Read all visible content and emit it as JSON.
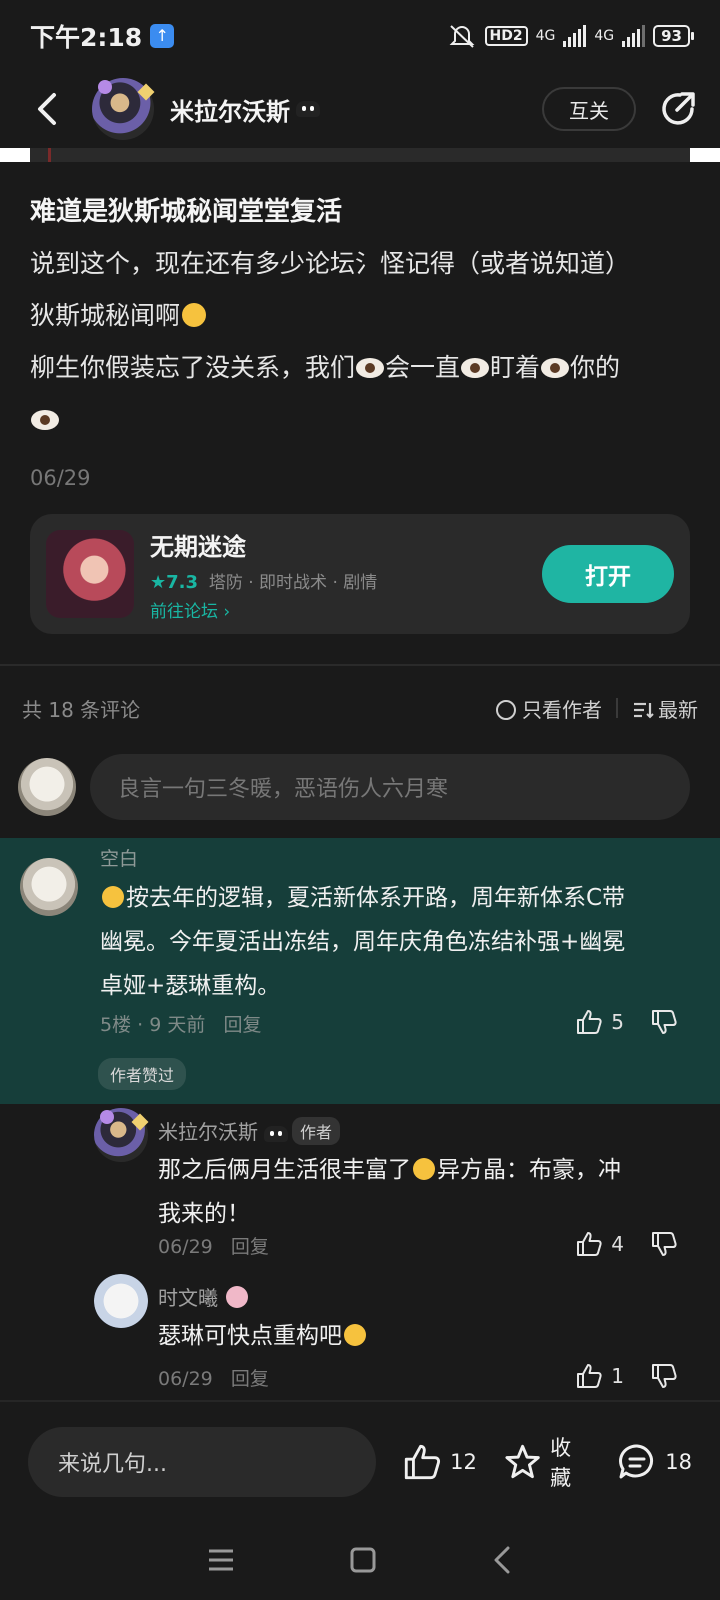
{
  "status_bar": {
    "time": "下午2:18",
    "network_hd": "HD2",
    "net1": "4G",
    "net2": "4G",
    "battery": "93"
  },
  "header": {
    "username": "米拉尔沃斯",
    "follow_label": "互关"
  },
  "post": {
    "title": "难道是狄斯城秘闻堂堂复活",
    "line1": "说到这个，现在还有多少论坛氵怪记得（或者说知道）",
    "line2": "狄斯城秘闻啊",
    "line3_a": "柳生你假装忘了没关系，我们",
    "line3_b": "会一直",
    "line3_c": "盯着",
    "line3_d": "你的",
    "date": "06/29"
  },
  "game_card": {
    "title": "无期迷途",
    "score": "★7.3",
    "tags": "塔防 · 即时战术 · 剧情",
    "forum_link": "前往论坛",
    "open_label": "打开"
  },
  "comments_header": {
    "count_label": "共 18 条评论",
    "author_only": "只看作者",
    "sort": "最新"
  },
  "comment_input": {
    "placeholder": "良言一句三冬暖，恶语伤人六月寒"
  },
  "top_comment": {
    "name": "空白",
    "text_a": "按去年的逻辑，夏活新体系开路，周年新体系C带",
    "text_b": "幽冕。今年夏活出冻结，周年庆角色冻结补强+幽冕",
    "text_c": "卓娅+瑟琳重构。",
    "floor": "5楼",
    "time": "9 天前",
    "reply": "回复",
    "likes": "5",
    "author_liked": "作者赞过"
  },
  "replies": [
    {
      "name": "米拉尔沃斯",
      "tag": "作者",
      "text_a": "那之后俩月生活很丰富了",
      "text_b": "异方晶：布豪，冲",
      "text_c": "我来的！",
      "date": "06/29",
      "reply": "回复",
      "likes": "4"
    },
    {
      "name": "时文曦",
      "text": "瑟琳可快点重构吧",
      "date": "06/29",
      "reply": "回复",
      "likes": "1"
    }
  ],
  "bottom_bar": {
    "input_placeholder": "来说几句...",
    "likes": "12",
    "favorite_label": "收藏",
    "comments": "18"
  },
  "colors": {
    "background": "#1a1a1a",
    "accent": "#1fb5a3",
    "highlight_comment": "#163e3a"
  }
}
